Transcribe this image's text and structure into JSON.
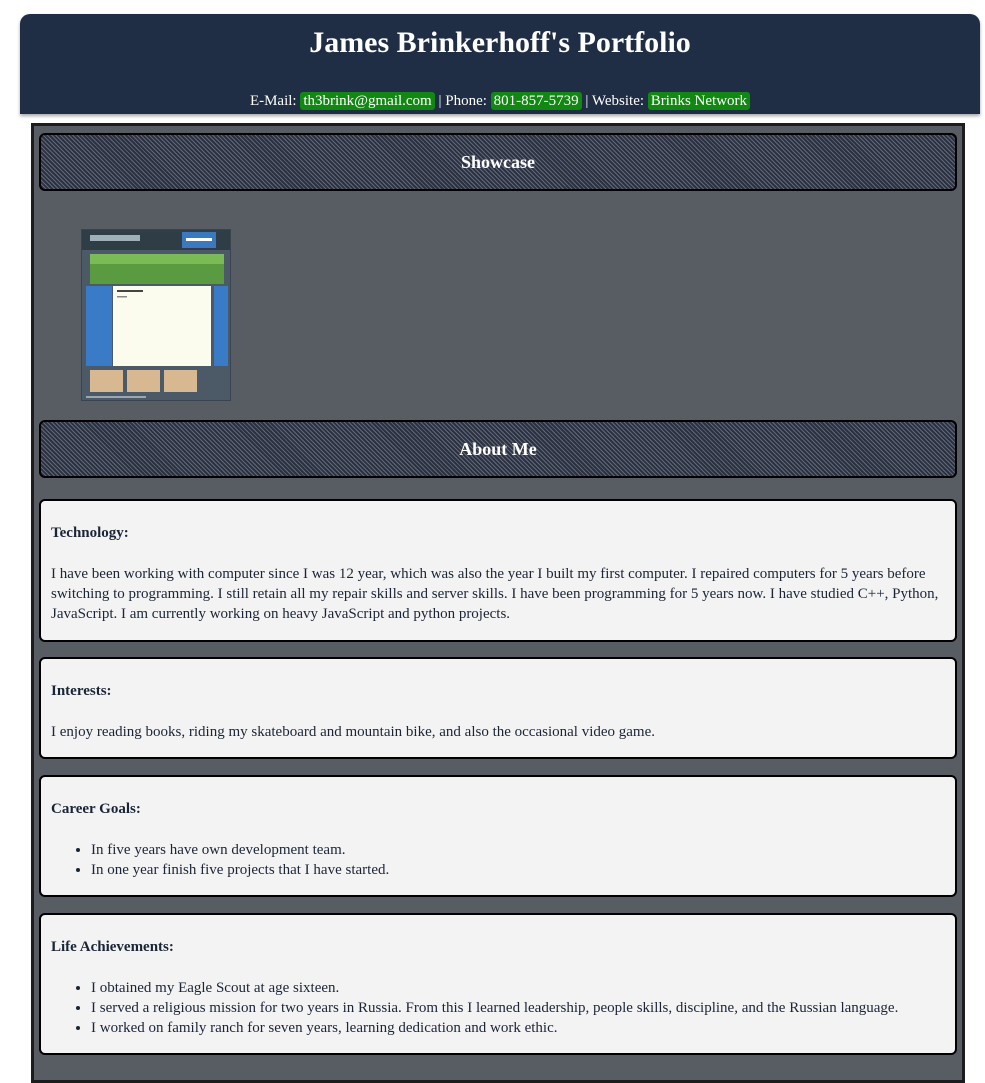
{
  "header": {
    "title": "James Brinkerhoff's Portfolio",
    "email_label": "E-Mail:",
    "email": "th3brink@gmail.com",
    "sep1": "|",
    "phone_label": "Phone:",
    "phone": "801-857-5739",
    "sep2": "|",
    "website_label": "Website:",
    "website": "Brinks Network"
  },
  "showcase": {
    "heading": "Showcase"
  },
  "about": {
    "heading": "About Me",
    "technology": {
      "title": "Technology:",
      "text": "I have been working with computer since I was 12 year, which was also the year I built my first computer. I repaired computers for 5 years before switching to programming. I still retain all my repair skills and server skills. I have been programming for 5 years now. I have studied C++, Python, JavaScript. I am currently working on heavy JavaScript and python projects."
    },
    "interests": {
      "title": "Interests:",
      "text": "I enjoy reading books, riding my skateboard and mountain bike, and also the occasional video game."
    },
    "career": {
      "title": "Career Goals:",
      "items": [
        "In five years have own development team.",
        "In one year finish five projects that I have started."
      ]
    },
    "life": {
      "title": "Life Achievements:",
      "items": [
        "I obtained my Eagle Scout at age sixteen.",
        "I served a religious mission for two years in Russia. From this I learned leadership, people skills, discipline, and the Russian language.",
        "I worked on family ranch for seven years, learning dedication and work ethic."
      ]
    }
  },
  "colors": {
    "header_bg": "#1f2d45",
    "link_chip": "#118811",
    "panel_bg": "#585c63",
    "card_bg": "#f3f3f3"
  }
}
